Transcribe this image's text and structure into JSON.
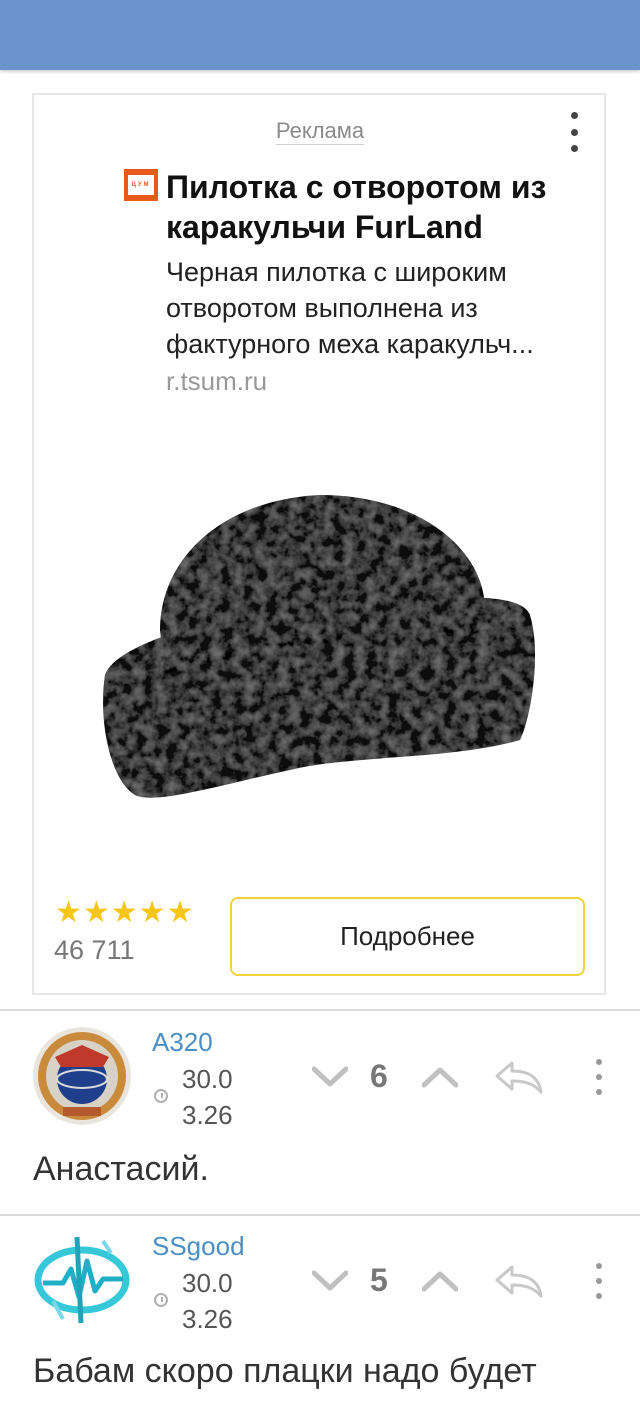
{
  "ad": {
    "label": "Реклама",
    "title": "Пилотка с отворотом из каракульчи FurLand",
    "description": "Черная пилотка с широким отворотом выполнена из фактурного меха каракульч...",
    "domain": "r.tsum.ru",
    "brand_logo_text": "ЦУМ",
    "rating_stars": 5,
    "rating_count": "46 711",
    "more_button": "Подробнее",
    "colors": {
      "logo": "#e85a1c",
      "button_border": "#f0d23a",
      "stars": "#f5c518"
    }
  },
  "comments": [
    {
      "username": "A320",
      "date": "30.0\n3.26",
      "score": "6",
      "text": "Анастасий.",
      "avatar_icon": "pilot-badge-icon"
    },
    {
      "username": "SSgood",
      "date": "30.0\n3.26",
      "score": "5",
      "text": "Бабам скоро плацки надо будет",
      "avatar_icon": "tech-emblem-icon"
    }
  ],
  "colors": {
    "topbar": "#6a93cc",
    "username": "#4b8fc4"
  }
}
